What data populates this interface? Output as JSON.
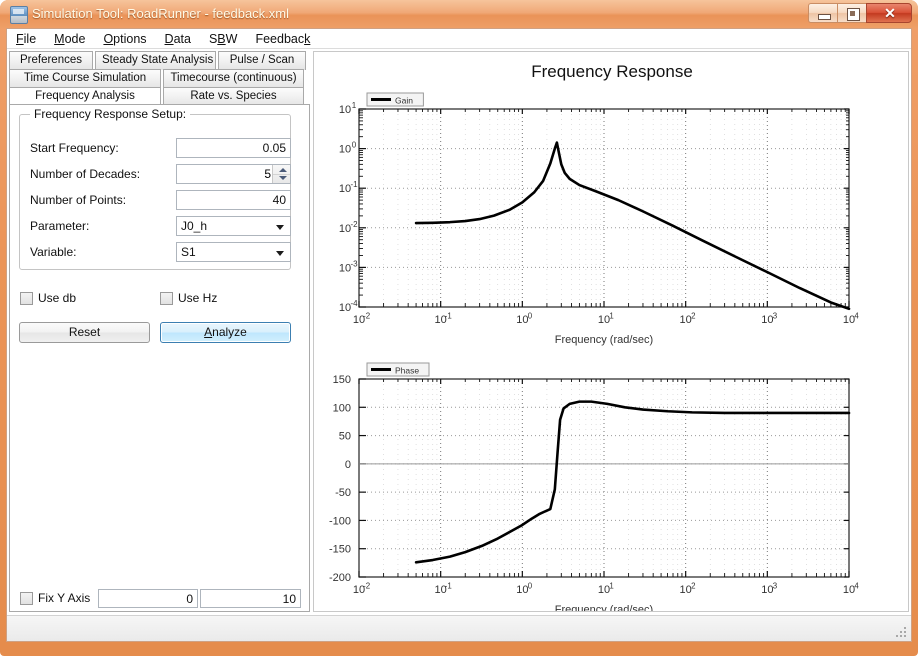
{
  "window": {
    "title": "Simulation Tool: RoadRunner - feedback.xml",
    "icon": "app-icon",
    "minimize": "–",
    "maximize": "□",
    "close": "✕"
  },
  "menu": [
    {
      "label": "File",
      "mnemonic": "F"
    },
    {
      "label": "Mode",
      "mnemonic": "M"
    },
    {
      "label": "Options",
      "mnemonic": "O"
    },
    {
      "label": "Data",
      "mnemonic": "D"
    },
    {
      "label": "SBW",
      "mnemonic": "B"
    },
    {
      "label": "Feedback",
      "mnemonic": "k"
    }
  ],
  "tabs": {
    "row1": [
      {
        "label": "Preferences",
        "active": false
      },
      {
        "label": "Steady State Analysis",
        "active": false
      },
      {
        "label": "Pulse / Scan",
        "active": false
      }
    ],
    "row2": [
      {
        "label": "Time Course Simulation",
        "active": false
      },
      {
        "label": "Timecourse (continuous)",
        "active": false
      }
    ],
    "row3": [
      {
        "label": "Frequency Analysis",
        "active": true
      },
      {
        "label": "Rate vs. Species",
        "active": false
      }
    ]
  },
  "setup": {
    "group_title": "Frequency Response Setup:",
    "fields": [
      {
        "label": "Start Frequency:",
        "value": "0.05",
        "type": "text"
      },
      {
        "label": "Number of Decades:",
        "value": "5",
        "type": "spinner"
      },
      {
        "label": "Number of Points:",
        "value": "40",
        "type": "text"
      },
      {
        "label": "Parameter:",
        "value": "J0_h",
        "type": "combo"
      },
      {
        "label": "Variable:",
        "value": "S1",
        "type": "combo"
      }
    ]
  },
  "options": {
    "use_db": {
      "label": "Use db",
      "checked": false
    },
    "use_hz": {
      "label": "Use Hz",
      "checked": false
    }
  },
  "buttons": {
    "reset": "Reset",
    "analyze": "Analyze",
    "analyze_mnemonic": "A"
  },
  "fix_y_axis": {
    "label": "Fix Y Axis",
    "checked": false,
    "min": "0",
    "max": "10"
  },
  "chart_data": [
    {
      "type": "line",
      "title": "Frequency Response",
      "subplot": "gain",
      "legend": [
        "Gain"
      ],
      "legend_position": "top-left",
      "xlabel": "Frequency (rad/sec)",
      "ylabel": "",
      "xscale": "log",
      "yscale": "log",
      "xlim": [
        0.01,
        10000
      ],
      "ylim": [
        0.0001,
        10
      ],
      "xticks": [
        "10^-2",
        "10^-1",
        "10^0",
        "10^1",
        "10^2",
        "10^3",
        "10^4"
      ],
      "yticks": [
        "10^1",
        "10^0",
        "10^-1",
        "10^-2",
        "10^-3",
        "10^-4"
      ],
      "grid": true,
      "line_color": "#000000",
      "x": [
        0.05,
        0.08,
        0.13,
        0.2,
        0.3,
        0.45,
        0.7,
        1.0,
        1.4,
        1.8,
        2.2,
        2.5,
        2.65,
        2.8,
        3.0,
        3.3,
        3.8,
        5.0,
        8.0,
        15,
        30,
        70,
        160,
        400,
        1000,
        2500,
        6000,
        10000
      ],
      "values": [
        0.0132,
        0.0134,
        0.0139,
        0.0148,
        0.0166,
        0.0203,
        0.0286,
        0.0438,
        0.079,
        0.154,
        0.42,
        1.0,
        1.42,
        0.8,
        0.4,
        0.245,
        0.172,
        0.12,
        0.083,
        0.05,
        0.026,
        0.0112,
        0.0048,
        0.0019,
        0.00076,
        0.0003,
        0.00013,
        9e-05
      ]
    },
    {
      "type": "line",
      "subplot": "phase",
      "legend": [
        "Phase"
      ],
      "legend_position": "top-left",
      "xlabel": "Frequency (rad/sec)",
      "ylabel": "",
      "xscale": "log",
      "yscale": "linear",
      "xlim": [
        0.01,
        10000
      ],
      "ylim": [
        -200,
        150
      ],
      "xticks": [
        "10^-2",
        "10^-1",
        "10^0",
        "10^1",
        "10^2",
        "10^3",
        "10^4"
      ],
      "yticks": [
        "150",
        "100",
        "50",
        "0",
        "-50",
        "-100",
        "-150",
        "-200"
      ],
      "grid": true,
      "line_color": "#000000",
      "x": [
        0.05,
        0.08,
        0.13,
        0.2,
        0.32,
        0.5,
        0.75,
        1.0,
        1.3,
        1.6,
        1.9,
        2.2,
        2.5,
        2.7,
        2.9,
        3.2,
        3.8,
        5.0,
        7.0,
        11,
        18,
        30,
        60,
        120,
        300,
        800,
        2500,
        10000
      ],
      "values": [
        -174,
        -170,
        -164,
        -156,
        -145,
        -132,
        -118,
        -108,
        -97,
        -89,
        -84,
        -80,
        -45,
        20,
        78,
        98,
        106,
        110,
        110,
        106,
        100,
        96,
        93,
        91,
        90,
        90,
        90,
        90
      ]
    }
  ]
}
